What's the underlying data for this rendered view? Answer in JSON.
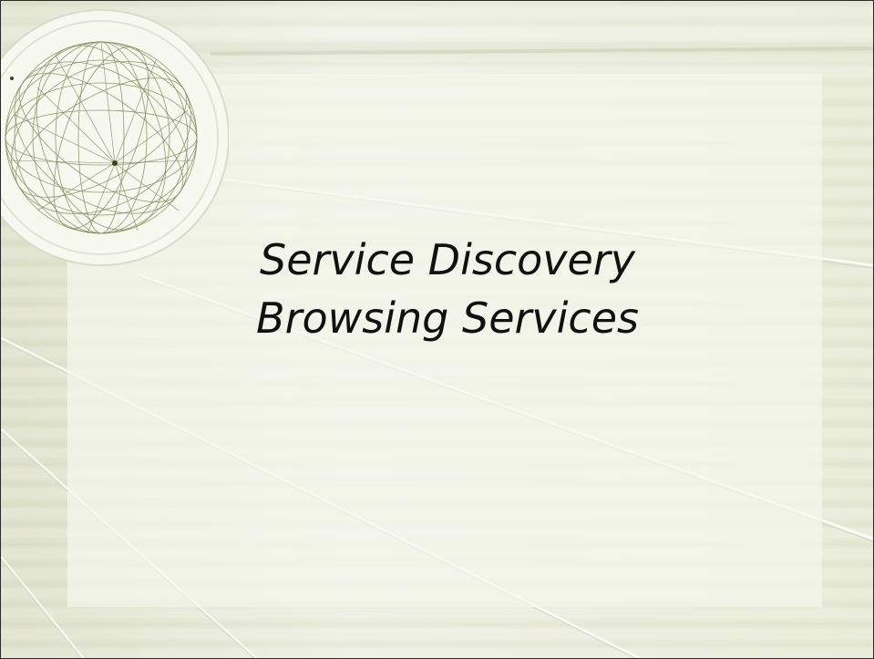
{
  "slide": {
    "title_line1": "Service Discovery",
    "title_line2": "Browsing Services"
  },
  "theme": {
    "background": "#e6e8d6",
    "panel": "#f5f6ec",
    "line_color": "#c9ccb2",
    "globe_line_color": "#8a8f5e",
    "text_color": "#111111"
  },
  "icons": {
    "decoration": "globe-wireframe-icon"
  }
}
